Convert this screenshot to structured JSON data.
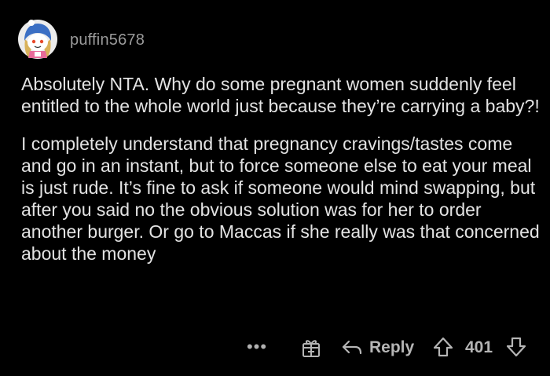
{
  "comment": {
    "username": "puffin5678",
    "avatar_icon": "snoo-avatar-icon",
    "paragraphs": [
      "Absolutely NTA. Why do some pregnant women suddenly feel entitled to the whole world just because they’re carrying a baby?!",
      "I completely understand that pregnancy cravings/tastes come and go in an instant, but to force someone else to eat your meal is just rude. It’s fine to ask if someone would mind swapping, but after you said no the obvious solution was for her to order another burger. Or go to Maccas if she really was that concerned about the money"
    ]
  },
  "actions": {
    "more_label": "•••",
    "reply_label": "Reply",
    "score": "401",
    "icons": {
      "more": "more-options-icon",
      "award": "award-icon",
      "reply": "reply-arrow-icon",
      "upvote": "upvote-arrow-icon",
      "downvote": "downvote-arrow-icon"
    }
  },
  "colors": {
    "background": "#000000",
    "text": "#e3e3e3",
    "muted": "#9a9a9a",
    "action": "#b5b5b5"
  }
}
